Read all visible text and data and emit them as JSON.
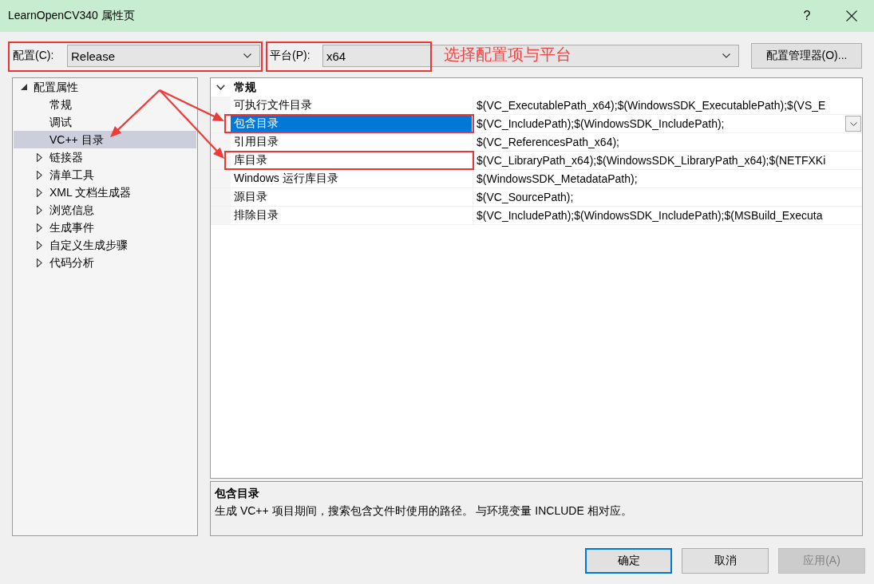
{
  "window": {
    "title": "LearnOpenCV340 属性页",
    "help_button": "?"
  },
  "configuration": {
    "label": "配置(C):",
    "value": "Release"
  },
  "platform": {
    "label": "平台(P):",
    "value": "x64"
  },
  "configuration_manager_button": "配置管理器(O)...",
  "annotation_note": "选择配置项与平台",
  "tree": [
    {
      "label": "配置属性",
      "kind": "group",
      "expanded": true,
      "selected": false,
      "children": [
        {
          "label": "常规",
          "kind": "page",
          "selected": false
        },
        {
          "label": "调试",
          "kind": "page",
          "selected": false
        },
        {
          "label": "VC++ 目录",
          "kind": "page",
          "selected": true
        },
        {
          "label": "链接器",
          "kind": "group",
          "expanded": false,
          "selected": false
        },
        {
          "label": "清单工具",
          "kind": "group",
          "expanded": false,
          "selected": false
        },
        {
          "label": "XML 文档生成器",
          "kind": "group",
          "expanded": false,
          "selected": false
        },
        {
          "label": "浏览信息",
          "kind": "group",
          "expanded": false,
          "selected": false
        },
        {
          "label": "生成事件",
          "kind": "group",
          "expanded": false,
          "selected": false
        },
        {
          "label": "自定义生成步骤",
          "kind": "group",
          "expanded": false,
          "selected": false
        },
        {
          "label": "代码分析",
          "kind": "group",
          "expanded": false,
          "selected": false
        }
      ]
    }
  ],
  "property_grid": {
    "categories": [
      {
        "label": "常规",
        "expanded": true,
        "rows": [
          {
            "name": "可执行文件目录",
            "value": "$(VC_ExecutablePath_x64);$(WindowsSDK_ExecutablePath);$(VS_E",
            "selected": false,
            "annotated": false
          },
          {
            "name": "包含目录",
            "value": "$(VC_IncludePath);$(WindowsSDK_IncludePath);",
            "selected": true,
            "annotated": true
          },
          {
            "name": "引用目录",
            "value": "$(VC_ReferencesPath_x64);",
            "selected": false,
            "annotated": false
          },
          {
            "name": "库目录",
            "value": "$(VC_LibraryPath_x64);$(WindowsSDK_LibraryPath_x64);$(NETFXKi",
            "selected": false,
            "annotated": true
          },
          {
            "name": "Windows 运行库目录",
            "value": "$(WindowsSDK_MetadataPath);",
            "selected": false,
            "annotated": false
          },
          {
            "name": "源目录",
            "value": "$(VC_SourcePath);",
            "selected": false,
            "annotated": false
          },
          {
            "name": "排除目录",
            "value": "$(VC_IncludePath);$(WindowsSDK_IncludePath);$(MSBuild_Executa",
            "selected": false,
            "annotated": false
          }
        ]
      }
    ]
  },
  "description": {
    "title": "包含目录",
    "text": "生成 VC++ 项目期间，搜索包含文件时使用的路径。 与环境变量 INCLUDE 相对应。"
  },
  "buttons": [
    {
      "label": "确定",
      "default": true,
      "disabled": false
    },
    {
      "label": "取消",
      "default": false,
      "disabled": false
    },
    {
      "label": "应用(A)",
      "default": false,
      "disabled": true
    }
  ]
}
